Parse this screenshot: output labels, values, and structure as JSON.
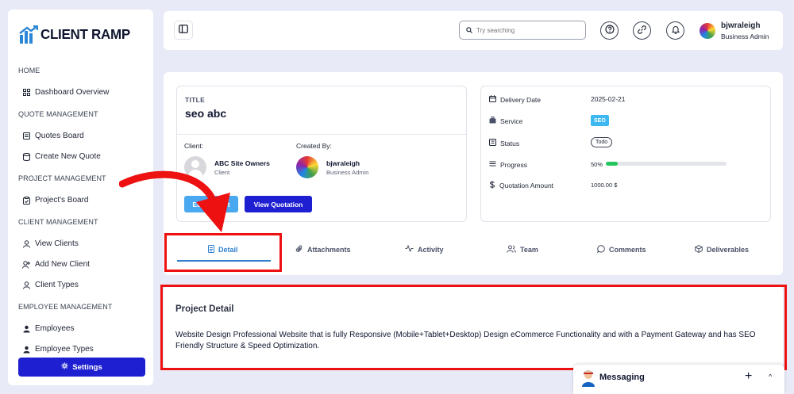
{
  "brand": {
    "name": "CLIENT RAMP"
  },
  "sidebar": {
    "sections": [
      {
        "title": "HOME",
        "items": [
          {
            "label": "Dashboard Overview",
            "icon": "grid-icon"
          }
        ]
      },
      {
        "title": "QUOTE MANAGEMENT",
        "items": [
          {
            "label": "Quotes Board",
            "icon": "board-icon"
          },
          {
            "label": "Create New Quote",
            "icon": "database-icon"
          }
        ]
      },
      {
        "title": "PROJECT MANAGEMENT",
        "items": [
          {
            "label": "Project's Board",
            "icon": "clipboard-icon"
          }
        ]
      },
      {
        "title": "CLIENT MANAGEMENT",
        "items": [
          {
            "label": "View Clients",
            "icon": "user-icon"
          },
          {
            "label": "Add New Client",
            "icon": "user-plus-icon"
          },
          {
            "label": "Client Types",
            "icon": "user-icon"
          }
        ]
      },
      {
        "title": "EMPLOYEE MANAGEMENT",
        "items": [
          {
            "label": "Employees",
            "icon": "user-icon"
          },
          {
            "label": "Employee Types",
            "icon": "user-icon"
          }
        ]
      }
    ],
    "settings_label": "Settings"
  },
  "header": {
    "search_placeholder": "Try searching",
    "user": {
      "name": "bjwraleigh",
      "role": "Business Admin"
    }
  },
  "project": {
    "title_label": "TITLE",
    "title": "seo abc",
    "client_label": "Client:",
    "client": {
      "name": "ABC Site Owners",
      "role": "Client"
    },
    "created_by_label": "Created By:",
    "creator": {
      "name": "bjwraleigh",
      "role": "Business Admin"
    },
    "edit_label": "Edit Project",
    "view_quotation_label": "View Quotation"
  },
  "info": {
    "delivery_date_label": "Delivery Date",
    "delivery_date": "2025-02-21",
    "service_label": "Service",
    "service": "SEO",
    "status_label": "Status",
    "status": "Todo",
    "progress_label": "Progress",
    "progress_text": "50%",
    "progress_value": 0.1,
    "quotation_label": "Quotation Amount",
    "quotation_amount": "1000.00 $"
  },
  "tabs": [
    {
      "label": "Detail",
      "icon": "document-icon",
      "active": true
    },
    {
      "label": "Attachments",
      "icon": "paperclip-icon"
    },
    {
      "label": "Activity",
      "icon": "activity-icon"
    },
    {
      "label": "Team",
      "icon": "team-icon"
    },
    {
      "label": "Comments",
      "icon": "comment-icon"
    },
    {
      "label": "Deliverables",
      "icon": "box-icon"
    }
  ],
  "detail": {
    "title": "Project Detail",
    "text": "Website Design Professional Website that is fully Responsive (Mobile+Tablet+Desktop) Design eCommerce Functionality and with a Payment Gateway and has SEO Friendly Structure & Speed Optimization."
  },
  "messaging": {
    "label": "Messaging"
  },
  "colors": {
    "primary": "#1d1fd0",
    "accent": "#2f7fd0",
    "annotation": "#ee1111",
    "progress": "#22c55e"
  }
}
